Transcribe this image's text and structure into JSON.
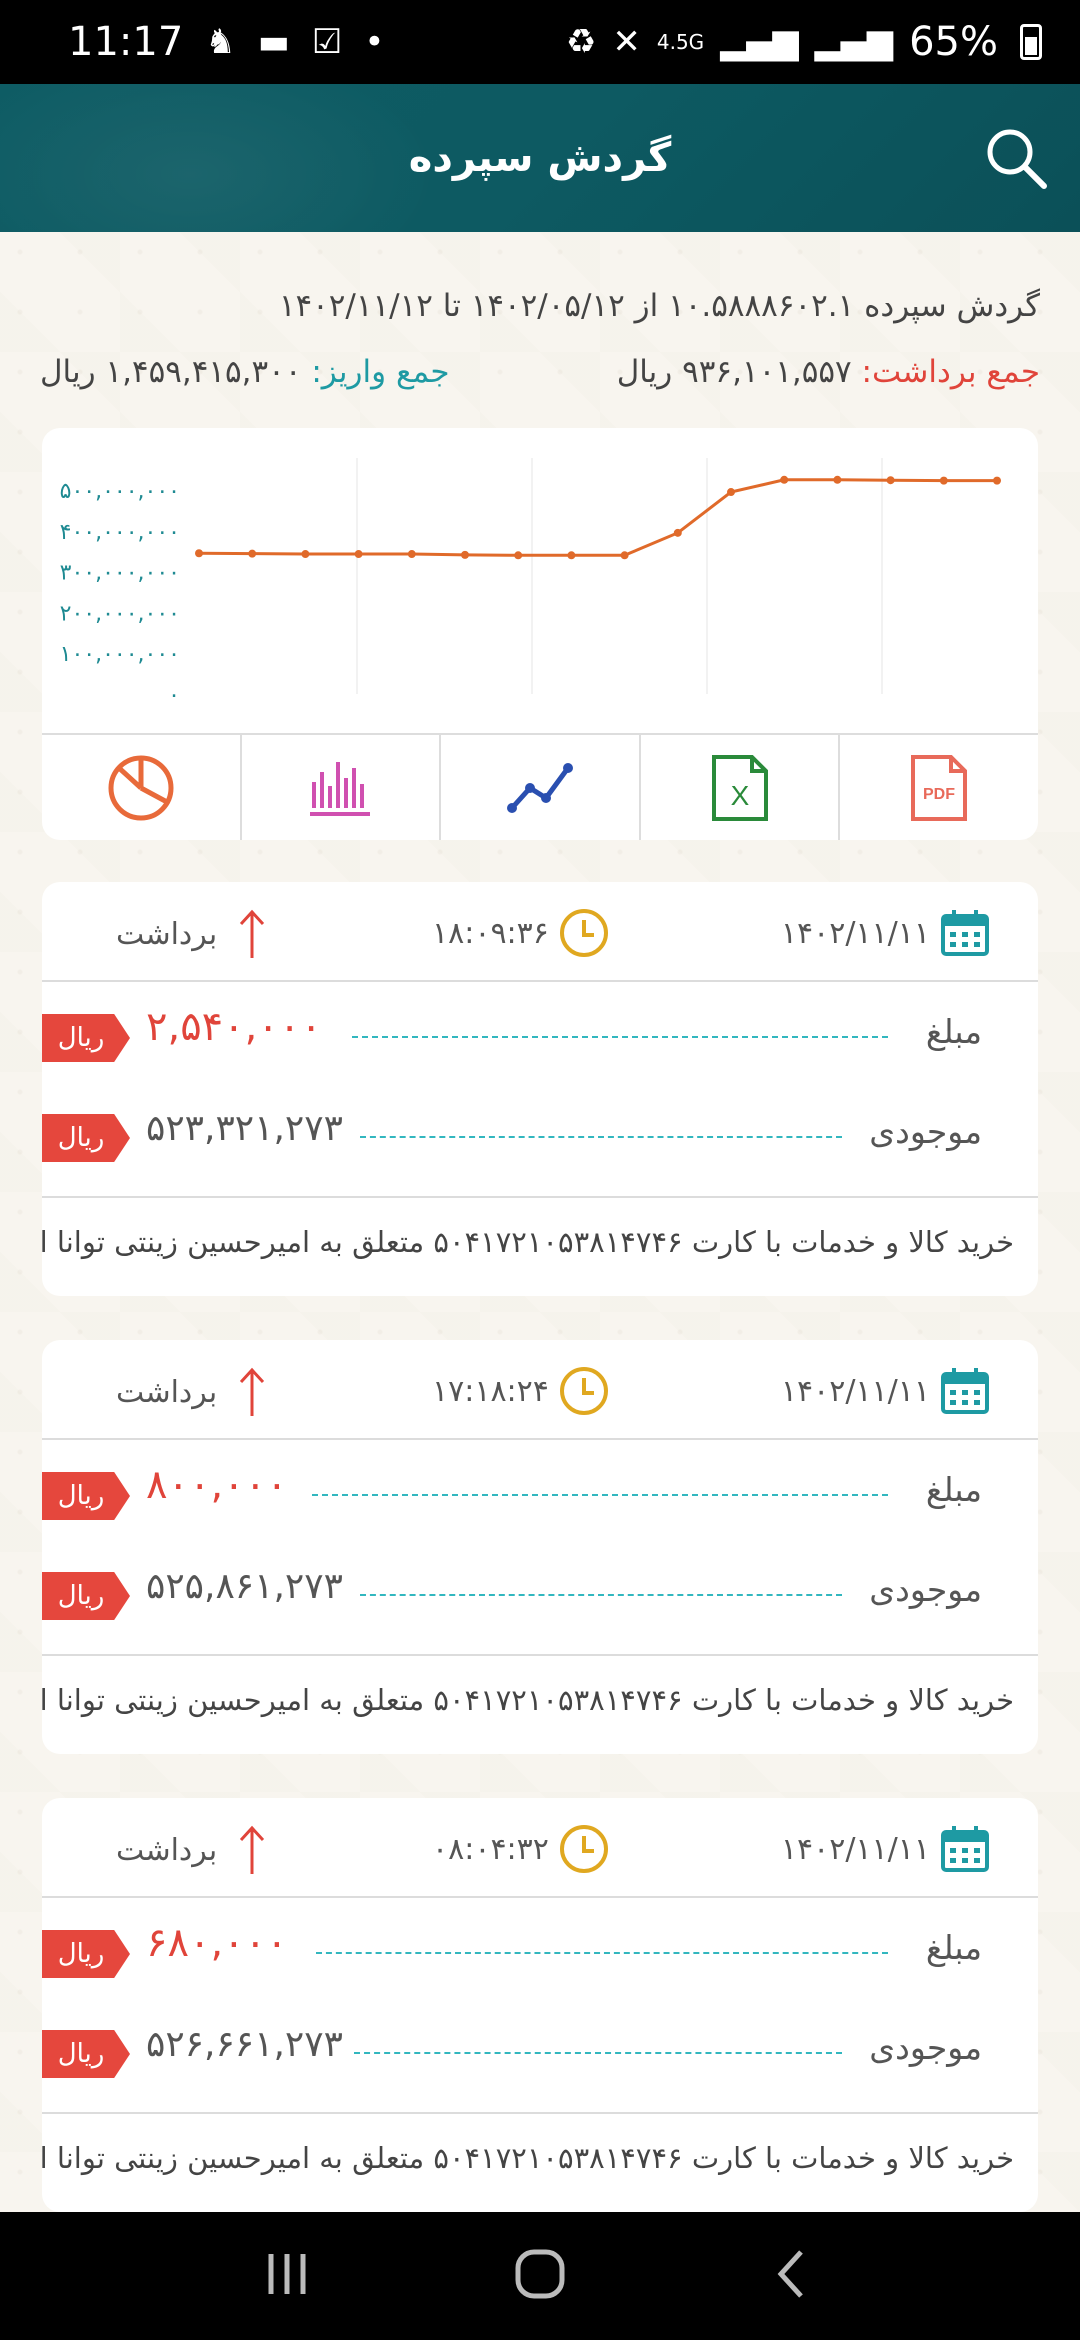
{
  "status_bar": {
    "time": "11:17",
    "network": "4.5G",
    "battery": "65%"
  },
  "header": {
    "title": "گردش سپرده"
  },
  "summary": {
    "line1": "گردش سپرده ۱۰.۵۸۸۸۶۰۲.۱ از ۱۴۰۲/۰۵/۱۲ تا ۱۴۰۲/۱۱/۱۲",
    "withdraw_label": "جمع برداشت:",
    "withdraw_value": "۹۳۶,۱۰۱,۵۵۷ ریال",
    "deposit_label": "جمع واریز:",
    "deposit_value": "۱,۴۵۹,۴۱۵,۳۰۰ ریال"
  },
  "chart_data": {
    "type": "line",
    "y_tick_labels": [
      "۵۰۰,۰۰۰,۰۰۰",
      "۴۰۰,۰۰۰,۰۰۰",
      "۳۰۰,۰۰۰,۰۰۰",
      "۲۰۰,۰۰۰,۰۰۰",
      "۱۰۰,۰۰۰,۰۰۰",
      "۰"
    ],
    "ylim": [
      0,
      500000000
    ],
    "values": [
      345000000,
      344000000,
      343000000,
      343000000,
      343000000,
      341000000,
      340000000,
      340000000,
      340000000,
      395000000,
      495000000,
      525000000,
      525000000,
      524000000,
      523000000,
      523000000
    ],
    "color": "#e06a2a",
    "grid": true
  },
  "toolbar": {
    "pie_icon": "pie-chart-icon",
    "bar_icon": "bar-chart-icon",
    "line_icon": "line-chart-icon",
    "excel_icon": "excel-icon",
    "pdf_icon": "pdf-icon",
    "pdf_label": "PDF",
    "excel_label": "X"
  },
  "transactions": [
    {
      "date": "۱۴۰۲/۱۱/۱۱",
      "time": "۱۸:۰۹:۳۶",
      "type": "برداشت",
      "amount_label": "مبلغ",
      "amount": "۲,۵۴۰,۰۰۰",
      "balance_label": "موجودی",
      "balance": "۵۲۳,۳۲۱,۲۷۳",
      "currency": "ریال",
      "description": "خرید کالا و خدمات با کارت ۵۰۴۱۷۲۱۰۵۳۸۱۴۷۴۶ متعلق به امیرحسین زینتی توانا از پ."
    },
    {
      "date": "۱۴۰۲/۱۱/۱۱",
      "time": "۱۷:۱۸:۲۴",
      "type": "برداشت",
      "amount_label": "مبلغ",
      "amount": "۸۰۰,۰۰۰",
      "balance_label": "موجودی",
      "balance": "۵۲۵,۸۶۱,۲۷۳",
      "currency": "ریال",
      "description": "خرید کالا و خدمات با کارت ۵۰۴۱۷۲۱۰۵۳۸۱۴۷۴۶ متعلق به امیرحسین زینتی توانا از پ."
    },
    {
      "date": "۱۴۰۲/۱۱/۱۱",
      "time": "۰۸:۰۴:۳۲",
      "type": "برداشت",
      "amount_label": "مبلغ",
      "amount": "۶۸۰,۰۰۰",
      "balance_label": "موجودی",
      "balance": "۵۲۶,۶۶۱,۲۷۳",
      "currency": "ریال",
      "description": "خرید کالا و خدمات با کارت ۵۰۴۱۷۲۱۰۵۳۸۱۴۷۴۶ متعلق به امیرحسین زینتی توانا از پ."
    }
  ],
  "colors": {
    "header_bg": "#0d5a62",
    "withdraw_red": "#e0443a",
    "teal": "#1e9aa3",
    "clock_gold": "#e0a820"
  }
}
